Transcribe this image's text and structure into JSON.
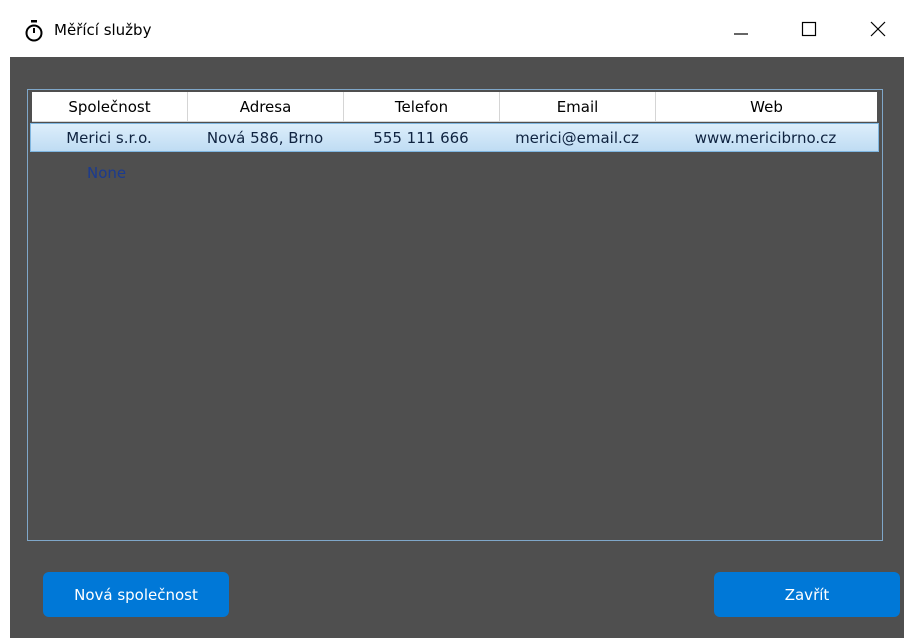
{
  "window": {
    "title": "Měřící služby",
    "icon": "stopwatch-icon",
    "controls": {
      "minimize": "minimize-icon",
      "maximize": "maximize-icon",
      "close": "close-icon"
    }
  },
  "grid": {
    "columns": [
      "Společnost",
      "Adresa",
      "Telefon",
      "Email",
      "Web"
    ],
    "rows": [
      {
        "company": "Merici s.r.o.",
        "address": "Nová 586, Brno",
        "phone": "555 111 666",
        "email": "merici@email.cz",
        "web": "www.mericibrno.cz"
      }
    ],
    "empty_row_text": "None"
  },
  "buttons": {
    "new_company": "Nová společnost",
    "close": "Zavřít"
  },
  "colors": {
    "background": "#4f4f4f",
    "accent": "#0078d7",
    "selected_row": "#cde6f7"
  }
}
